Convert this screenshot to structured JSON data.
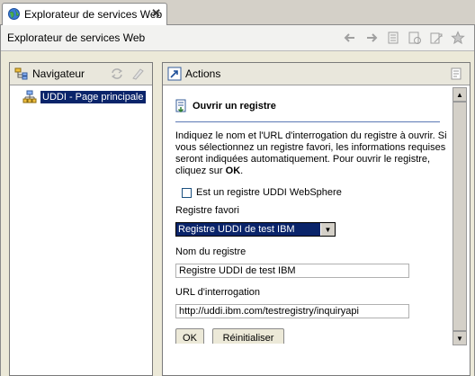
{
  "tab": {
    "title": "Explorateur de services Web",
    "close": "✕"
  },
  "editor": {
    "title": "Explorateur de services Web"
  },
  "toolbar": {
    "icons": [
      "back-arrow-icon",
      "forward-arrow-icon",
      "history-icon",
      "favorites-icon",
      "add-favorite-icon",
      "star-icon"
    ]
  },
  "navigator": {
    "title": "Navigateur",
    "tree": [
      {
        "label": "UDDI - Page principale"
      }
    ]
  },
  "actions": {
    "title": "Actions",
    "section_title": "Ouvrir un registre",
    "description": "Indiquez le nom et l'URL d'interrogation du registre à ouvrir. Si vous sélectionnez un registre favori, les informations requises seront indiquées automatiquement. Pour ouvrir le registre, cliquez sur ",
    "description_bold": "OK",
    "description_end": ".",
    "checkbox_label": "Est un registre UDDI WebSphere",
    "favorite_label": "Registre favori",
    "favorite_value": "Registre UDDI de test IBM",
    "name_label": "Nom du registre",
    "name_value": "Registre UDDI de test IBM",
    "url_label": "URL d'interrogation",
    "url_value": "http://uddi.ibm.com/testregistry/inquiryapi",
    "ok_label": "OK",
    "reset_label": "Réinitialiser"
  }
}
